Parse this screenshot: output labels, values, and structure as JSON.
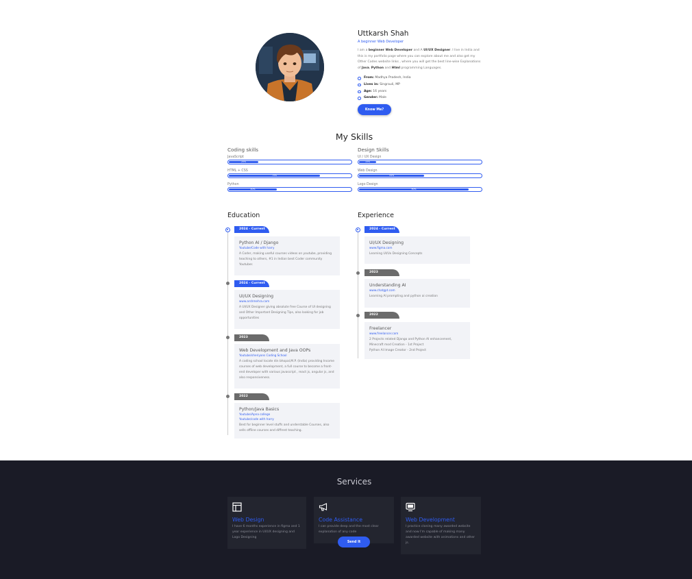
{
  "about": {
    "name": "Uttkarsh Shah",
    "role": "A beginner Web Developer",
    "bio_parts": [
      "I am a ",
      "beginner Web Developer",
      " and A ",
      "UI/UX Designer",
      ". I live in India and this is my portfolio page where you can explore about me and also get my Other Codes website links , where you will get the best line-wise Explanations of ",
      "Java",
      ", ",
      "Python",
      " and ",
      "Html",
      " programming Languages."
    ],
    "facts": [
      {
        "label": "From:",
        "value": " Madhya Pradesh, India"
      },
      {
        "label": "Lives in:",
        "value": " Singrauli, MP"
      },
      {
        "label": "Age:",
        "value": " 16 years"
      },
      {
        "label": "Gender:",
        "value": " Male"
      }
    ],
    "button": "Know Me?"
  },
  "skills": {
    "title": "My Skills",
    "coding": {
      "heading": "Coding skills",
      "items": [
        {
          "label": "JavaScript",
          "value": 25,
          "text": "25%"
        },
        {
          "label": "HTML + CSS",
          "value": 75,
          "text": "75%"
        },
        {
          "label": "Python",
          "value": 40,
          "text": "40%"
        }
      ]
    },
    "design": {
      "heading": "Design Skills",
      "items": [
        {
          "label": "UI / UX Design",
          "value": 15,
          "text": "15%"
        },
        {
          "label": "Web Design",
          "value": 54,
          "text": "54%"
        },
        {
          "label": "Logo Design",
          "value": 90,
          "text": "90%"
        }
      ]
    }
  },
  "education": {
    "title": "Education",
    "entries": [
      {
        "tag": "2024 - Current",
        "tag_color": "blue",
        "title": "Python AI / Django",
        "links": [
          "Youtube/Code with harry"
        ],
        "desc": "A Coder, making useful courses videos on youtube, providing teaching to others, #1 in Indian best Coder community Youtuber."
      },
      {
        "tag": "2024 - Current",
        "tag_color": "blue",
        "title": "UI/UX Designing",
        "links": [
          "www.arshmehra.com"
        ],
        "desc": "A UI/UX Designer giving absolute free Course of UI designing and Other Important Designing Tips, also looking for job opportunities"
      },
      {
        "tag": "2023",
        "tag_color": "grey",
        "title": "Web Development and Java OOPs",
        "links": [
          "Youtube/sheriyans Coding School"
        ],
        "desc": "A coding school locate din bhopal,M.P. (India) providing Income courses of web development, a full course to become a front-end developer with various javascript , react js, angular js, and also responsiveness."
      },
      {
        "tag": "2022",
        "tag_color": "grey",
        "title": "Python/Java Basics",
        "links": [
          "Youtube/Apna college",
          "Youtube/code with harry"
        ],
        "desc": "Best for beginner level stuffs and understable Courses, also sells offline courses and diffrent teaching."
      }
    ]
  },
  "experience": {
    "title": "Experience",
    "entries": [
      {
        "tag": "2024 - Current",
        "tag_color": "blue",
        "title": "UI/UX Designing",
        "links": [
          "www.figma.com"
        ],
        "desc": "Learning UI/Ux Designing Concepts"
      },
      {
        "tag": "2023",
        "tag_color": "grey",
        "title": "Understanding AI",
        "links": [
          "www.chatgpt.com"
        ],
        "desc": "Learning AI prompting and python ai creation"
      },
      {
        "tag": "2022",
        "tag_color": "grey",
        "title": "Freelancer",
        "links": [
          "www.freelancer.com"
        ],
        "desc": "2 Projects related Django and Python AI enhancement, Minecraft mod Creation - 1st Project\nPython AI Image Creator - 2nd Project"
      }
    ]
  },
  "services": {
    "title": "Services",
    "items": [
      {
        "icon": "layout-icon",
        "title": "Web Design",
        "desc": "I have 6 months experience in figma and 1 year experience in UI/UX designing and Logo Designing"
      },
      {
        "icon": "megaphone-icon",
        "title": "Code Assistance",
        "desc": "I can provide deep and the most clear explanation of any code"
      },
      {
        "icon": "monitor-icon",
        "title": "Web Development",
        "desc": "I practice cloning many awarded website and now I'm capable of making many awarded website with animations and other js."
      }
    ],
    "button": "Send It"
  },
  "colors": {
    "accent": "#2f5cf0",
    "footer_bg": "#1a1b26",
    "grey_tag": "#6b6b6b"
  }
}
